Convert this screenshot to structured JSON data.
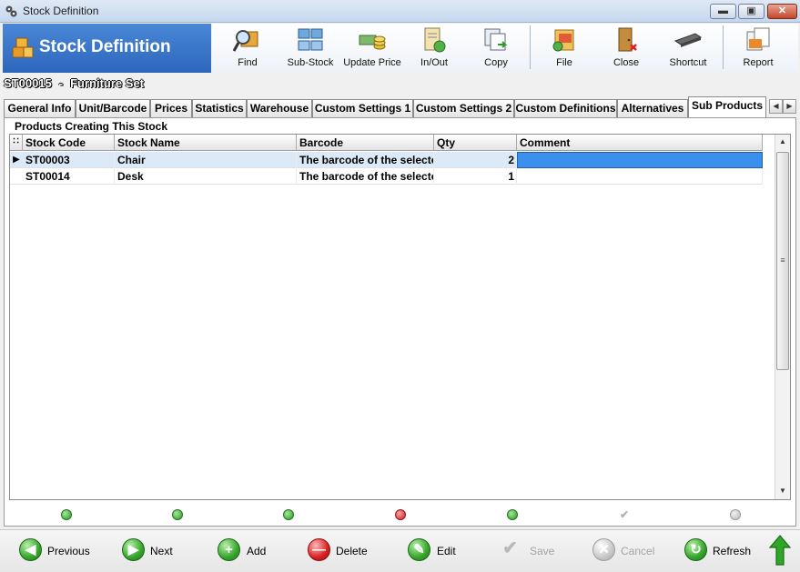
{
  "window": {
    "title": "Stock Definition"
  },
  "header": {
    "title": "Stock Definition"
  },
  "toolbar": {
    "find": "Find",
    "sub_stock": "Sub-Stock",
    "update_price": "Update Price",
    "in_out": "In/Out",
    "copy": "Copy",
    "file": "File",
    "close": "Close",
    "shortcut": "Shortcut",
    "report": "Report"
  },
  "record": {
    "code": "ST00015",
    "separator": "-",
    "name": "Furniture Set"
  },
  "tabs": [
    "General Info",
    "Unit/Barcode",
    "Prices",
    "Statistics",
    "Warehouse",
    "Custom Settings 1",
    "Custom Settings 2",
    "Custom Definitions",
    "Alternatives",
    "Sub Products"
  ],
  "active_tab": "Sub Products",
  "group": {
    "label": "Products Creating This Stock"
  },
  "grid": {
    "columns": [
      "Stock Code",
      "Stock Name",
      "Barcode",
      "Qty",
      "Comment"
    ],
    "rows": [
      {
        "code": "ST00003",
        "name": "Chair",
        "barcode": "The barcode of the selecte",
        "qty": "2",
        "comment": ""
      },
      {
        "code": "ST00014",
        "name": "Desk",
        "barcode": "The barcode of the selecte",
        "qty": "1",
        "comment": ""
      }
    ]
  },
  "bottom": {
    "previous": "Previous",
    "next": "Next",
    "add": "Add",
    "delete": "Delete",
    "edit": "Edit",
    "save": "Save",
    "cancel": "Cancel",
    "refresh": "Refresh"
  },
  "colors": {
    "brand_blue": "#2d67bd",
    "selection_blue": "#3d8fee",
    "row_highlight": "#dbe9f8"
  }
}
